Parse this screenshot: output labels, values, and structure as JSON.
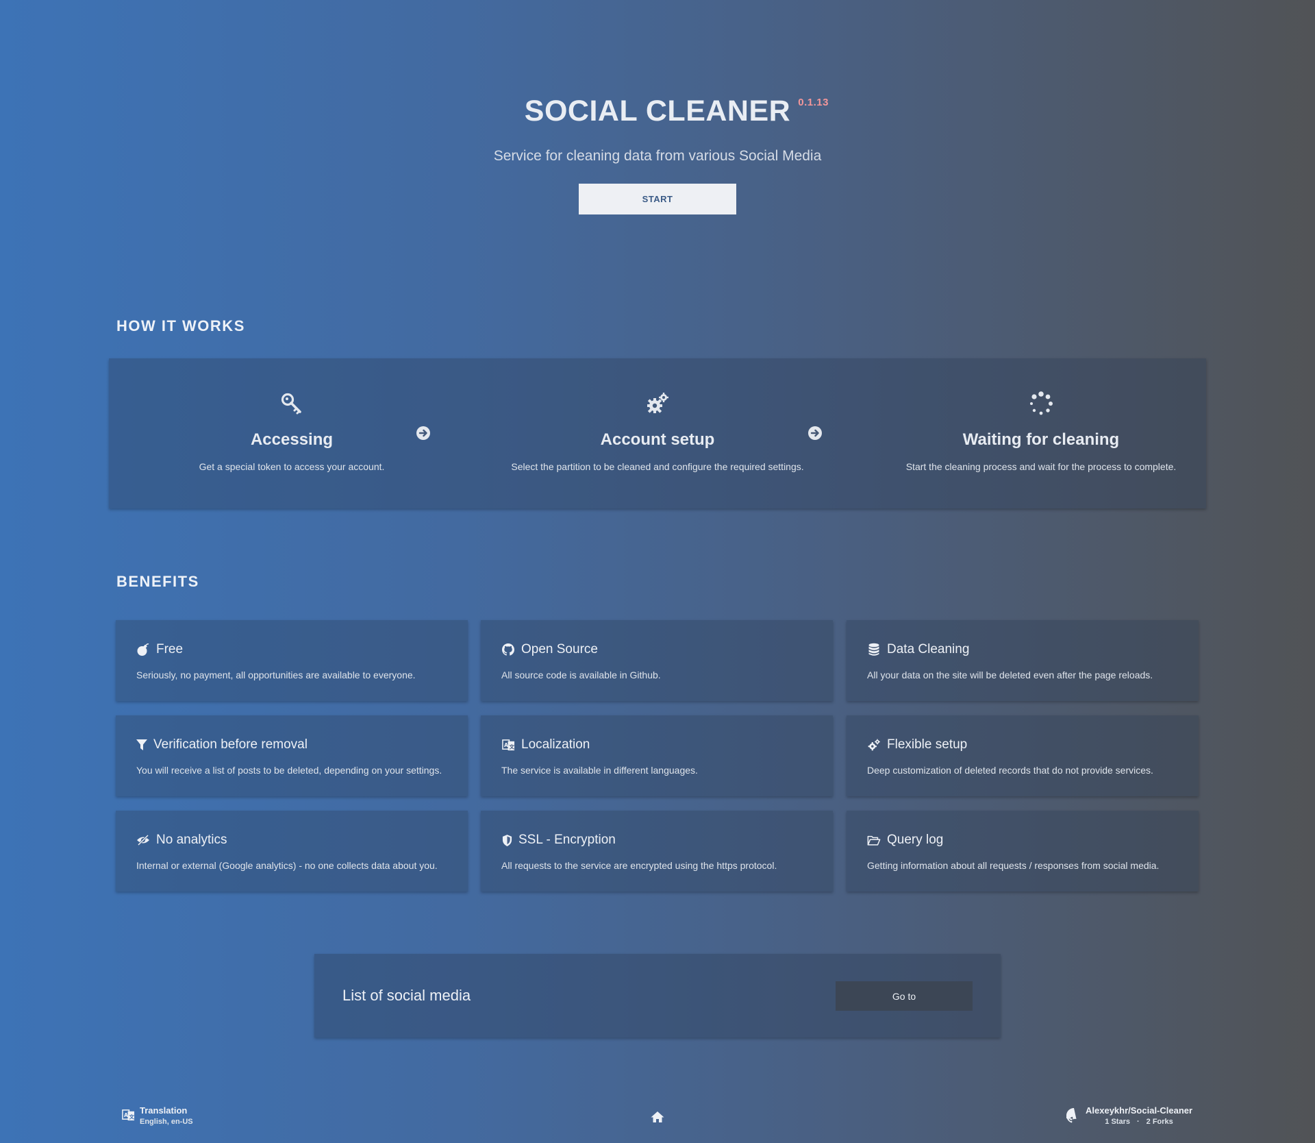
{
  "hero": {
    "title": "SOCIAL CLEANER",
    "version": "0.1.13",
    "subtitle": "Service for cleaning data from various Social Media",
    "start_label": "START"
  },
  "how_it_works": {
    "heading": "HOW IT WORKS",
    "steps": [
      {
        "title": "Accessing",
        "description": "Get a special token to access your account.",
        "icon": "key-icon"
      },
      {
        "title": "Account setup",
        "description": "Select the partition to be cleaned and configure the required settings.",
        "icon": "gears-icon"
      },
      {
        "title": "Waiting for cleaning",
        "description": "Start the cleaning process and wait for the process to complete.",
        "icon": "spinner-icon"
      }
    ]
  },
  "benefits": {
    "heading": "BENEFITS",
    "items": [
      {
        "title": "Free",
        "description": "Seriously, no payment, all opportunities are available to everyone.",
        "icon": "bomb-icon"
      },
      {
        "title": "Open Source",
        "description": "All source code is available in Github.",
        "icon": "github-icon"
      },
      {
        "title": "Data Cleaning",
        "description": "All your data on the site will be deleted even after the page reloads.",
        "icon": "database-icon"
      },
      {
        "title": "Verification before removal",
        "description": "You will receive a list of posts to be deleted, depending on your settings.",
        "icon": "filter-icon"
      },
      {
        "title": "Localization",
        "description": "The service is available in different languages.",
        "icon": "language-icon"
      },
      {
        "title": "Flexible setup",
        "description": "Deep customization of deleted records that do not provide services.",
        "icon": "gears-icon"
      },
      {
        "title": "No analytics",
        "description": "Internal or external (Google analytics) - no one collects data about you.",
        "icon": "eye-slash-icon"
      },
      {
        "title": "SSL - Encryption",
        "description": "All requests to the service are encrypted using the https protocol.",
        "icon": "shield-icon"
      },
      {
        "title": "Query log",
        "description": "Getting information about all requests / responses from social media.",
        "icon": "folder-open-icon"
      }
    ]
  },
  "social": {
    "title": "List of social media",
    "goto_label": "Go to"
  },
  "footer": {
    "translation_label": "Translation",
    "translation_value": "English, en-US",
    "repo_name": "Alexeykhr/Social-Cleaner",
    "stars": "1 Stars",
    "separator": "·",
    "forks": "2 Forks"
  },
  "colors": {
    "gradient_left": "#3d73b6",
    "gradient_right": "#515356",
    "version_accent": "#f4979a",
    "start_button_bg": "#eef0f4",
    "goto_button_bg": "#3c4655"
  }
}
